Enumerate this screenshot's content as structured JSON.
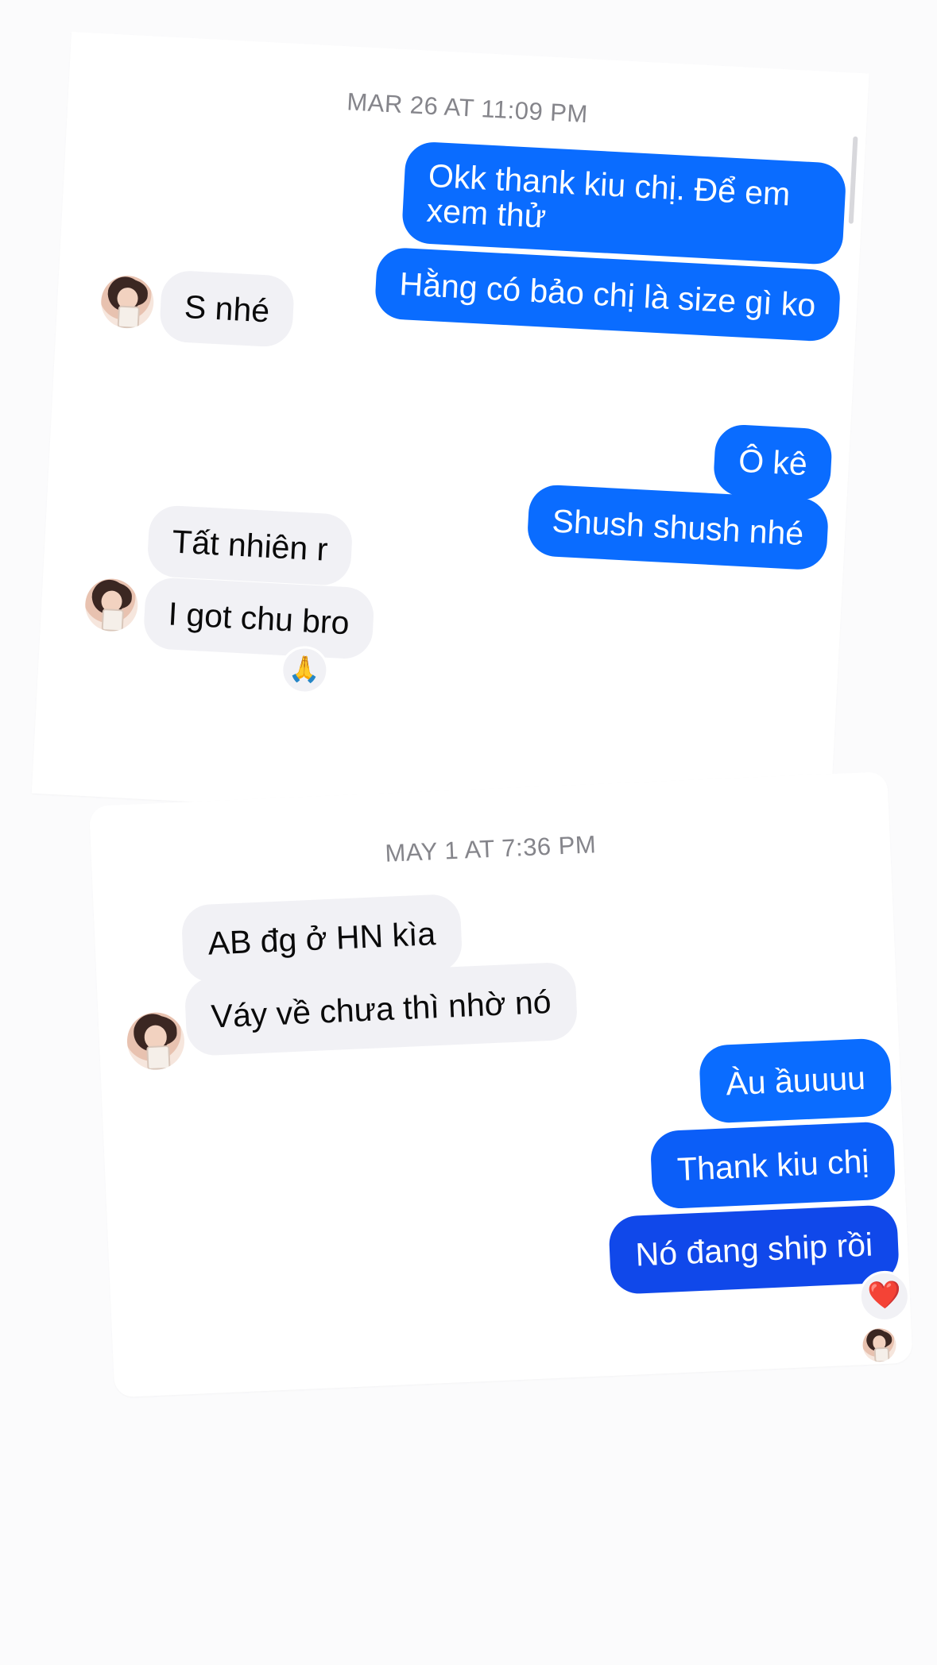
{
  "conversation": {
    "section1": {
      "timestamp": "MAR 26 AT 11:09 PM",
      "messages": [
        {
          "from": "me",
          "text_line1": "Okk thank kiu chị. Để em",
          "text_line2": "xem thử"
        },
        {
          "from": "me",
          "text": "Hằng có bảo chị là size gì ko"
        },
        {
          "from": "them",
          "text": "S nhé"
        },
        {
          "from": "me",
          "text": "Ô kê"
        },
        {
          "from": "me",
          "text": "Shush shush nhé"
        },
        {
          "from": "them",
          "text": "Tất nhiên r"
        },
        {
          "from": "them",
          "text": "I got chu bro",
          "reaction": "🙏"
        }
      ]
    },
    "section2": {
      "timestamp": "MAY 1 AT 7:36 PM",
      "messages": [
        {
          "from": "them",
          "text": "AB đg ở HN kìa"
        },
        {
          "from": "them",
          "text": "Váy về chưa thì nhờ nó"
        },
        {
          "from": "me",
          "text": "Àu ầuuuu"
        },
        {
          "from": "me",
          "text": "Thank kiu chị"
        },
        {
          "from": "me",
          "text": "Nó đang ship rồi",
          "reaction": "❤️"
        }
      ]
    }
  },
  "colors": {
    "outgoing": "#0a6cff",
    "outgoing_dark": "#1048ea",
    "incoming": "#f1f1f5",
    "timestamp": "#85858b"
  }
}
